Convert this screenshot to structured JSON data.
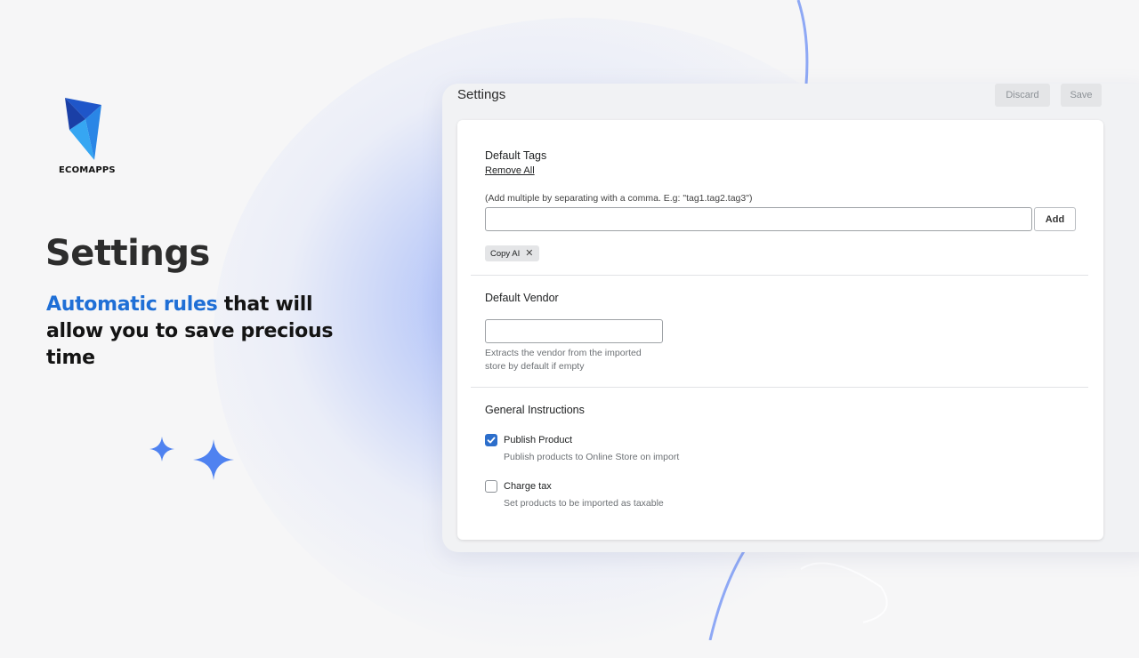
{
  "brand": {
    "name": "ECOMAPPS"
  },
  "hero": {
    "title": "Settings",
    "subtitle_accent": "Automatic rules",
    "subtitle_rest": " that will allow you to save precious time"
  },
  "colors": {
    "accent": "#1f6fd6",
    "checkbox_blue": "#2c6ecb",
    "sparkle": "#4f82f0"
  },
  "settings": {
    "title": "Settings",
    "discard_label": "Discard",
    "save_label": "Save",
    "default_tags": {
      "title": "Default Tags",
      "remove_all": "Remove All",
      "help": "(Add multiple by separating with a comma. E.g: \"tag1.tag2.tag3\")",
      "input_value": "",
      "add_label": "Add",
      "tags": [
        {
          "label": "Copy AI"
        }
      ]
    },
    "default_vendor": {
      "title": "Default Vendor",
      "input_value": "",
      "help_line1": "Extracts the vendor from the imported",
      "help_line2": "store by default if empty"
    },
    "general_instructions": {
      "title": "General Instructions",
      "options": [
        {
          "label": "Publish Product",
          "description": "Publish products to Online Store on import",
          "checked": true
        },
        {
          "label": "Charge tax",
          "description": "Set products to be imported as taxable",
          "checked": false
        }
      ]
    }
  }
}
